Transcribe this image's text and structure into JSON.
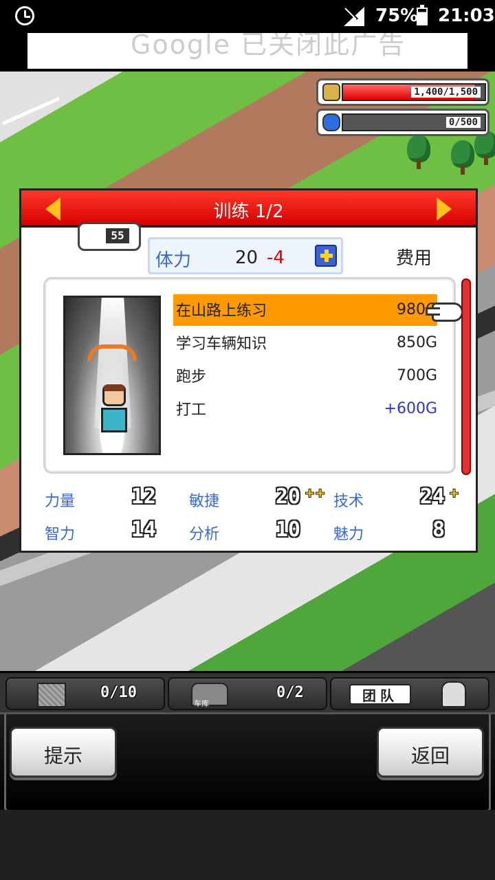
{
  "status_bar": {
    "battery": "75%",
    "time": "21:03"
  },
  "ad": {
    "text": "Google 已关闭此广告"
  },
  "resources": {
    "money": {
      "value": "1,400/1,500",
      "fill": 0.93
    },
    "research": {
      "value": "0/500",
      "fill": 0.0
    }
  },
  "dialog": {
    "title": "训练 1/2",
    "level_badge": "55",
    "stamina": {
      "label": "体力",
      "value": "20",
      "cost": "-4"
    },
    "cost_header": "费用",
    "training_items": [
      {
        "name": "在山路上练习",
        "cost": "980G",
        "selected": true
      },
      {
        "name": "学习车辆知识",
        "cost": "850G"
      },
      {
        "name": "跑步",
        "cost": "700G"
      },
      {
        "name": "打工",
        "cost": "+600G"
      }
    ],
    "stats": [
      {
        "label": "力量",
        "value": "12"
      },
      {
        "label": "敏捷",
        "value": "20",
        "plus": "++"
      },
      {
        "label": "技术",
        "value": "24",
        "plus": "+"
      },
      {
        "label": "智力",
        "value": "14"
      },
      {
        "label": "分析",
        "value": "10"
      },
      {
        "label": "魅力",
        "value": "8"
      }
    ]
  },
  "hud": {
    "storage": "0/10",
    "garage": {
      "label": "车库",
      "count": "0/2"
    },
    "team": "团队"
  },
  "buttons": {
    "hint": "提示",
    "back": "返回"
  },
  "colors": {
    "header_red": "#e00000",
    "selected_orange": "#ff9a00",
    "stat_blue": "#3a6ad0",
    "earn_blue": "#2a35d8"
  }
}
